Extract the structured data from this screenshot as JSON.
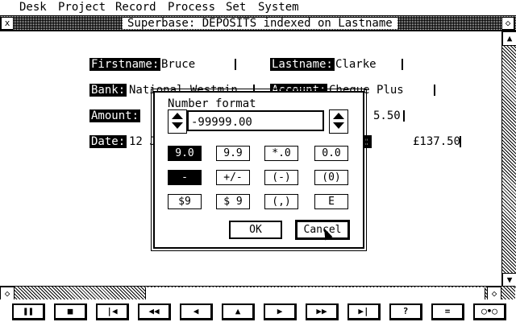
{
  "menu": [
    "Desk",
    "Project",
    "Record",
    "Process",
    "Set",
    "System"
  ],
  "window": {
    "title": "Superbase:  DEPOSITS indexed on Lastname",
    "close_glyph": "x",
    "full_glyph": "◇"
  },
  "record": {
    "firstname_label": "Firstname:",
    "firstname": "Bruce",
    "lastname_label": "Lastname:",
    "lastname": "Clarke",
    "bank_label": "Bank:",
    "bank": "National Westmin",
    "account_label": "Account:",
    "account": "Cheque Plus",
    "amount_label": "Amount:",
    "amount": "5.50",
    "date_label": "Date:",
    "date": "12 J",
    "balance_label": "t:",
    "balance": "£137.50"
  },
  "dialog": {
    "title": "Number format",
    "format_value": "-99999.00",
    "buttons": [
      "9.0",
      "9.9",
      "*.0",
      "0.0",
      "-",
      "+/-",
      "(-)",
      "(0)",
      "$9",
      "$ 9",
      "(,)",
      "E"
    ],
    "selected": [
      "9.0",
      "-"
    ],
    "ok": "OK",
    "cancel": "Cancel"
  },
  "toolbar": [
    "❚❚",
    "■",
    "|◀",
    "◀◀",
    "◀",
    "▲",
    "▶",
    "▶▶",
    "▶|",
    "?",
    "=",
    "◯•◯"
  ],
  "scroll_glyphs": {
    "up": "▲",
    "down": "▼",
    "left": "◇",
    "right": "◇"
  }
}
